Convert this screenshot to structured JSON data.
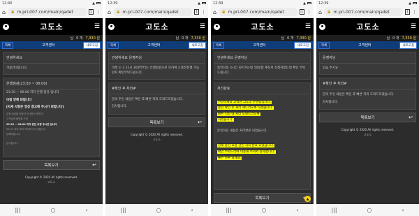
{
  "common": {
    "url": "m.pri-007.com/main/qadet",
    "logo": "고도소",
    "points_label": "님",
    "points_count": "0 개",
    "points_value": "7,330 원",
    "nav_left": "목록",
    "nav_title": "고객센터",
    "nav_right": "새로고침",
    "list_button": "목록보기",
    "copyright": "Copyright © 2020 All rights reserved.",
    "version": "고도소"
  },
  "panels": [
    {
      "time": "12:40",
      "greeting": "안녕하세요",
      "lines": [
        "가용안내입니다."
      ],
      "section_title": "은행점검(23:30 ~ 06:00)",
      "body": [
        "23:30 ~ 06:00 까지 은행 점검 입니다",
        "이점 양해 바랍니다",
        "[자세 사항은 영상 참고해 주시기 바랍니다]"
      ],
      "notes": [
        "은행 점검을 정확히 안내하지 못하여",
        "고객님께 불편을 드려",
        "23:30 ~ 06:00 까지 충전 요청 주시면 입니다",
        "06:00 이후 부터 처리하시기 바랍니다",
        "양해바랍니다."
      ],
      "closing": "감사합니다"
    },
    {
      "time": "12:39",
      "greeting": "안녕하세요 운영자님",
      "lines": [
        "미래 는 3 11시 30분부터는 은행점검으로 인하여 3 충전진행 가능한지 확인부탁드립니다."
      ],
      "section_title": "#확인 후 처리#",
      "body": [
        "문의 주신 내용은 확인 후 빠른 처리 도와드리겠습니다."
      ],
      "closing": "감사합니다."
    },
    {
      "time": "12:39",
      "greeting": "안녕하세요 운영자님",
      "lines": [
        "충전신청 3시간 되어가는데 50분쯤 계산서 신청하였는데 확인 부탁드립니다."
      ],
      "section_title": "처리완료",
      "highlights_top": [
        "안녕하세요 고객님 고도소 운영팀입니다.",
        "충전 확인 후 처리 해드리도록 하겠습니다.",
        "빠른 시일 내 처리 도와드리도록",
        "하겠습니다."
      ],
      "mid": "문의하신 내용은 처리완료 되었습니다.",
      "highlights_bottom": [
        "현재 충전 요청 건은 처리 완료 되었습니다.",
        "확인 부탁드리며 이용해 주셔서 감사합니다.",
        "좋은 하루 되세요."
      ]
    },
    {
      "time": "12:39",
      "greeting": "운영자님",
      "lines": [
        "입금 주시요"
      ],
      "section_title": "#확인 후 처리#",
      "body": [
        "문의 주신 내용은 확인 후 빠른 처리 도와드리겠습니다."
      ],
      "closing": "감사합니다."
    }
  ]
}
